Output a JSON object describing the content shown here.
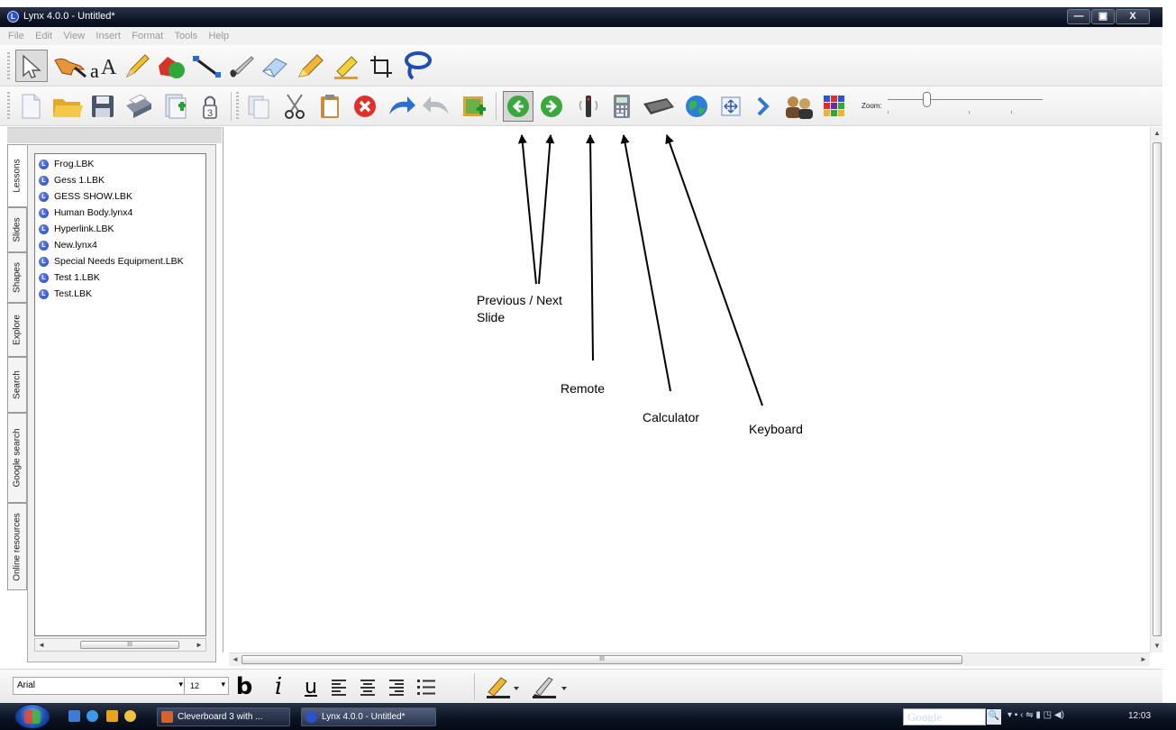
{
  "window": {
    "title": "Lynx 4.0.0 - Untitled*",
    "app_icon_letter": "L",
    "controls": {
      "minimize": "—",
      "maximize": "▣",
      "close": "X"
    }
  },
  "menu": [
    "File",
    "Edit",
    "View",
    "Insert",
    "Format",
    "Tools",
    "Help"
  ],
  "toolbar1": {
    "tools": [
      "select-arrow",
      "pen-hand",
      "text",
      "pencil",
      "shapes",
      "line",
      "brush",
      "eraser",
      "highlighter",
      "pen",
      "crop",
      "lasso"
    ]
  },
  "toolbar2": {
    "tools": [
      "new",
      "open",
      "save",
      "print",
      "import",
      "lock",
      "copy",
      "cut",
      "paste",
      "delete",
      "undo",
      "redo",
      "insert-image",
      "previous-slide",
      "next-slide",
      "remote",
      "calculator",
      "keyboard",
      "globe",
      "fullscreen",
      "more",
      "users",
      "color-grid"
    ],
    "zoom_label": "Zoom:",
    "zoom_level": 0.25
  },
  "side_tabs": [
    "Lessons",
    "Slides",
    "Shapes",
    "Explore",
    "Search",
    "Google search",
    "Online resources"
  ],
  "lessons": [
    "Frog.LBK",
    "Gess 1.LBK",
    "GESS SHOW.LBK",
    "Human Body.lynx4",
    "Hyperlink.LBK",
    "New.lynx4",
    "Special Needs Equipment.LBK",
    "Test 1.LBK",
    "Test.LBK"
  ],
  "scroll": {
    "left_arrow": "◄",
    "right_arrow": "►",
    "up_arrow": "▲",
    "down_arrow": "▼",
    "grip": "III",
    "vgrip": "≡"
  },
  "annotations": {
    "prev_next": "Previous / Next\nSlide",
    "remote": "Remote",
    "calculator": "Calculator",
    "keyboard": "Keyboard"
  },
  "format": {
    "font": "Arial",
    "size": "12",
    "dropdown": "▾",
    "bold": "b",
    "italic": "i",
    "underline": "u"
  },
  "taskbar": {
    "buttons": [
      "Cleverboard 3 with ...",
      "Lynx 4.0.0 - Untitled*"
    ],
    "search_text": "Google",
    "search_icon": "🔍",
    "tray_icons": "▾ ▪ ‹ ⇋   ▮ ◳ ◀)",
    "clock": "12:03"
  },
  "colors": {
    "next_green": "#3aa83c",
    "delete_red": "#e0302a",
    "accent_blue": "#2b52c8",
    "taskbar_dark": "#0c1424"
  }
}
